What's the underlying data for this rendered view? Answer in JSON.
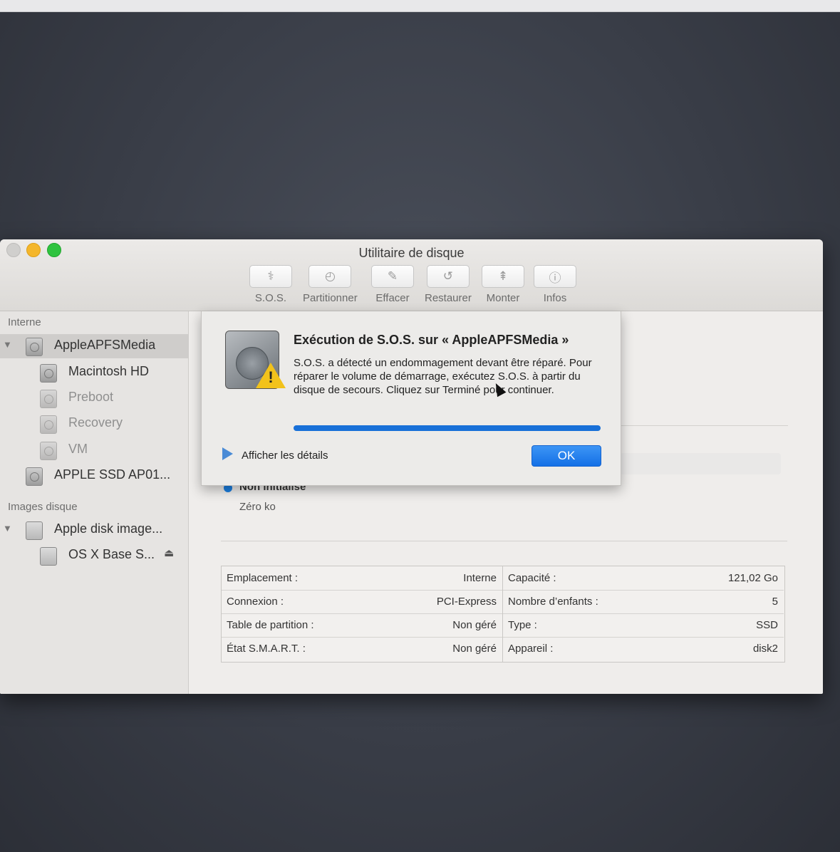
{
  "window": {
    "title": "Utilitaire de disque"
  },
  "toolbar": [
    {
      "label": "S.O.S.",
      "icon": "stethoscope-icon"
    },
    {
      "label": "Partitionner",
      "icon": "partition-icon"
    },
    {
      "label": "Effacer",
      "icon": "erase-icon"
    },
    {
      "label": "Restaurer",
      "icon": "restore-icon"
    },
    {
      "label": "Monter",
      "icon": "mount-icon"
    },
    {
      "label": "Infos",
      "icon": "info-icon"
    }
  ],
  "sidebar": {
    "section_internal": "Interne",
    "section_images": "Images disque",
    "items": [
      {
        "label": "AppleAPFSMedia",
        "selected": true
      },
      {
        "label": "Macintosh HD"
      },
      {
        "label": "Preboot"
      },
      {
        "label": "Recovery"
      },
      {
        "label": "VM"
      },
      {
        "label": "APPLE SSD AP01..."
      },
      {
        "label": "Apple disk image..."
      },
      {
        "label": "OS X Base S..."
      }
    ]
  },
  "main": {
    "legend_name": "Non initialisé",
    "legend_size": "Zéro ko",
    "legend_color": "#1b7ee0",
    "info_left": [
      {
        "key": "Emplacement :",
        "value": "Interne"
      },
      {
        "key": "Connexion :",
        "value": "PCI-Express"
      },
      {
        "key": "Table de partition :",
        "value": "Non géré"
      },
      {
        "key": "État S.M.A.R.T. :",
        "value": "Non géré"
      }
    ],
    "info_right": [
      {
        "key": "Capacité :",
        "value": "121,02 Go"
      },
      {
        "key": "Nombre d’enfants :",
        "value": "5"
      },
      {
        "key": "Type :",
        "value": "SSD"
      },
      {
        "key": "Appareil :",
        "value": "disk2"
      }
    ]
  },
  "dialog": {
    "title": "Exécution de S.O.S. sur « AppleAPFSMedia »",
    "message": "S.O.S. a détecté un endommagement devant être réparé. Pour réparer le volume de démarrage, exécutez S.O.S. à partir du disque de secours. Cliquez sur Terminé pour continuer.",
    "progress": 1.0,
    "details_label": "Afficher les détails",
    "ok_label": "OK",
    "accent": "#1870d8"
  }
}
